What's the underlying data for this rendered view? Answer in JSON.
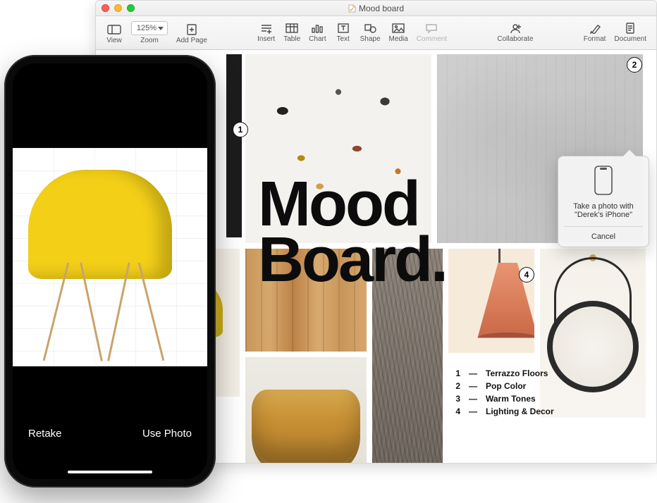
{
  "macWindow": {
    "title": "Mood board",
    "zoom": "125%",
    "toolbar": {
      "view": "View",
      "zoom": "Zoom",
      "addPage": "Add Page",
      "insert": "Insert",
      "table": "Table",
      "chart": "Chart",
      "text": "Text",
      "shape": "Shape",
      "media": "Media",
      "comment": "Comment",
      "collaborate": "Collaborate",
      "format": "Format",
      "document": "Document"
    },
    "canvas": {
      "title_line1": "Mood",
      "title_line2": "Board.",
      "badges": {
        "b1": "1",
        "b2": "2",
        "b4": "4"
      },
      "legend": [
        {
          "n": "1",
          "label": "Terrazzo Floors"
        },
        {
          "n": "2",
          "label": "Pop Color"
        },
        {
          "n": "3",
          "label": "Warm Tones"
        },
        {
          "n": "4",
          "label": "Lighting & Decor"
        }
      ]
    },
    "popover": {
      "line1": "Take a photo with",
      "line2": "\"Derek's iPhone\"",
      "cancel": "Cancel"
    }
  },
  "iphone": {
    "retake": "Retake",
    "usePhoto": "Use Photo"
  }
}
